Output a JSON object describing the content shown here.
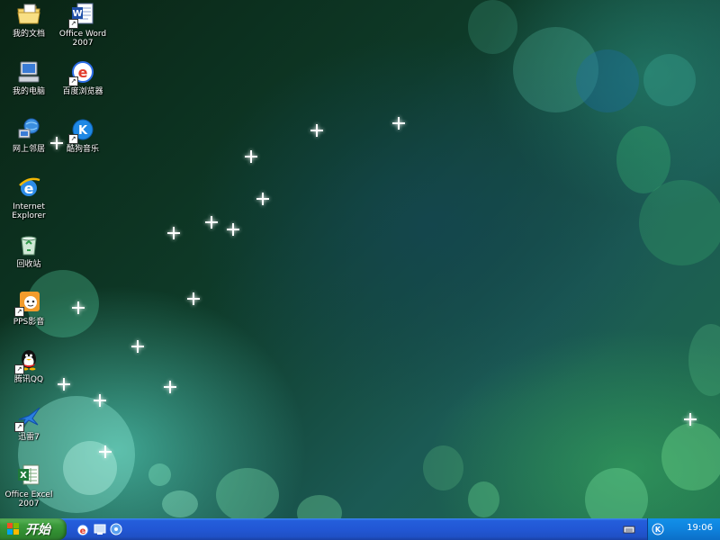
{
  "desktop": {
    "icons": [
      {
        "id": "my-documents",
        "label": "我的文档",
        "icon": "folder-documents-icon"
      },
      {
        "id": "my-computer",
        "label": "我的电脑",
        "icon": "computer-icon"
      },
      {
        "id": "network-places",
        "label": "网上邻居",
        "icon": "network-icon"
      },
      {
        "id": "internet-explorer",
        "label": "Internet Explorer",
        "icon": "internet-explorer-icon"
      },
      {
        "id": "recycle-bin",
        "label": "回收站",
        "icon": "recycle-bin-icon"
      },
      {
        "id": "pps",
        "label": "PPS影音",
        "icon": "pps-player-icon"
      },
      {
        "id": "qq",
        "label": "腾讯QQ",
        "icon": "qq-penguin-icon"
      },
      {
        "id": "xunlei",
        "label": "迅雷7",
        "icon": "xunlei-bird-icon"
      },
      {
        "id": "excel",
        "label": "Office Excel 2007",
        "icon": "excel-icon"
      },
      {
        "id": "word",
        "label": "Office Word 2007",
        "icon": "word-icon"
      },
      {
        "id": "baidu-browser",
        "label": "百度浏览器",
        "icon": "baidu-browser-icon"
      },
      {
        "id": "kugou",
        "label": "酷狗音乐",
        "icon": "kugou-music-icon"
      }
    ]
  },
  "taskbar": {
    "start_label": "开始",
    "quick_launch": [
      "ie-quicklaunch-icon",
      "show-desktop-icon",
      "media-quicklaunch-icon"
    ],
    "clock": "19:06",
    "tray_icons": [
      "keyboard-icon",
      "kugou-tray-icon"
    ]
  },
  "colors": {
    "taskbar_blue": "#245edb",
    "start_green": "#3c9b3c",
    "tray_blue": "#0f82dd"
  }
}
